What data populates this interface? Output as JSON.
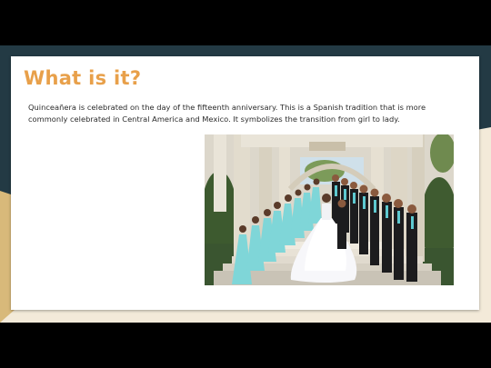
{
  "slide": {
    "title": "What is it?",
    "body": "Quinceañera is celebrated on the day of the fifteenth anniversary. This is a Spanish tradition that is more commonly celebrated in Central America and Mexico. It symbolizes the transition from girl to lady."
  },
  "photo": {
    "icon": "quinceanera-group-photo"
  },
  "colors": {
    "title": "#e8a04a",
    "background": "#233a44",
    "accent_cream": "#f3ead9",
    "accent_sand": "#d8b97a",
    "dress": "#7fd6d8"
  }
}
